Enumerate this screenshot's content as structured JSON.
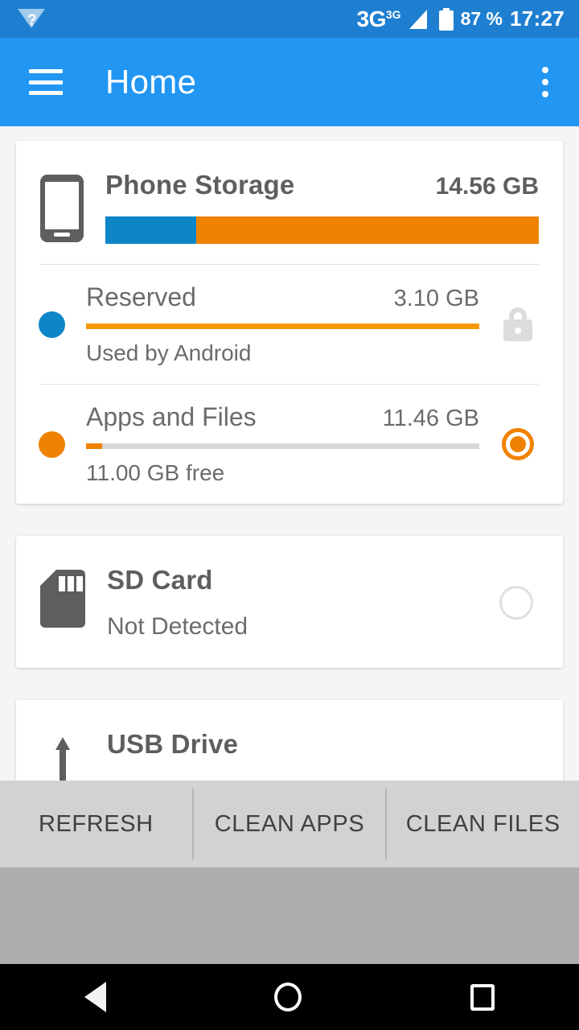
{
  "status_bar": {
    "wifi_icon": "wifi-question-icon",
    "network_type": "3G",
    "network_sup": "3G",
    "signal_icon": "signal-triangle-icon",
    "battery_icon": "battery-full-icon",
    "battery_pct": "87 %",
    "clock": "17:27"
  },
  "app_bar": {
    "menu_icon": "hamburger-menu-icon",
    "title": "Home",
    "overflow_icon": "more-vertical-icon"
  },
  "phone_storage": {
    "icon": "phone-icon",
    "title": "Phone Storage",
    "total": "14.56 GB",
    "bar": {
      "blue_pct": 21,
      "orange_pct": 79,
      "blue": "#0d86c8",
      "orange": "#ef8200"
    },
    "rows": [
      {
        "dot_color": "blue",
        "name": "Reserved",
        "value": "3.10 GB",
        "fill_pct": 100,
        "subtitle": "Used by Android",
        "control": "lock-icon"
      },
      {
        "dot_color": "orange",
        "name": "Apps and Files",
        "value": "11.46 GB",
        "fill_pct": 4,
        "subtitle": "11.00 GB free",
        "control": "radio-selected"
      }
    ]
  },
  "sd_card": {
    "icon": "sd-card-icon",
    "title": "SD Card",
    "subtitle": "Not Detected",
    "control": "radio-empty"
  },
  "usb_drive": {
    "icon": "usb-drive-icon",
    "title": "USB Drive"
  },
  "bottom_bar": {
    "refresh": "REFRESH",
    "clean_apps": "CLEAN APPS",
    "clean_files": "CLEAN FILES"
  },
  "nav_bar": {
    "back": "back-icon",
    "home": "home-icon",
    "recents": "recents-icon"
  },
  "colors": {
    "status_bar": "#1e7fd1",
    "app_bar": "#2196f3",
    "accent_orange": "#ef8200",
    "accent_blue": "#0d86c8",
    "page_bg": "#f5f5f5",
    "button_bar": "#d2d2d2"
  }
}
